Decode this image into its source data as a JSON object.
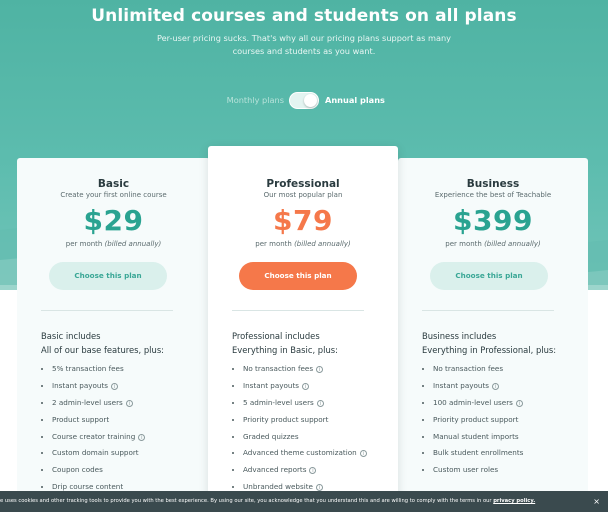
{
  "hero": {
    "headline": "Unlimited courses and students on all plans",
    "subtext": "Per-user pricing sucks. That's why all our pricing plans support as many courses and students as you want."
  },
  "billing_toggle": {
    "left_label": "Monthly plans",
    "right_label": "Annual plans",
    "selected": "Annual plans"
  },
  "colors": {
    "brand_teal": "#4fb3a3",
    "price_teal": "#2aa391",
    "price_orange": "#f5784a",
    "cookie_bar": "#3a4a4e"
  },
  "plans": [
    {
      "name": "Basic",
      "tagline": "Create your first online course",
      "price": "$29",
      "period": "per month",
      "billing_note": "(billed annually)",
      "cta": "Choose this plan",
      "includes_title": "Basic includes",
      "includes_sub": "All of our base features, plus:",
      "features": [
        {
          "label": "5% transaction fees",
          "info": false
        },
        {
          "label": "Instant payouts",
          "info": true
        },
        {
          "label": "2 admin-level users",
          "info": true
        },
        {
          "label": "Product support",
          "info": false
        },
        {
          "label": "Course creator training",
          "info": true
        },
        {
          "label": "Custom domain support",
          "info": false
        },
        {
          "label": "Coupon codes",
          "info": false
        },
        {
          "label": "Drip course content",
          "info": false
        }
      ]
    },
    {
      "name": "Professional",
      "tagline": "Our most popular plan",
      "price": "$79",
      "period": "per month",
      "billing_note": "(billed annually)",
      "cta": "Choose this plan",
      "includes_title": "Professional includes",
      "includes_sub": "Everything in Basic, plus:",
      "features": [
        {
          "label": "No transaction fees",
          "info": true
        },
        {
          "label": "Instant payouts",
          "info": true
        },
        {
          "label": "5 admin-level users",
          "info": true
        },
        {
          "label": "Priority product support",
          "info": false
        },
        {
          "label": "Graded quizzes",
          "info": false
        },
        {
          "label": "Advanced theme customization",
          "info": true
        },
        {
          "label": "Advanced reports",
          "info": true
        },
        {
          "label": "Unbranded website",
          "info": true
        }
      ]
    },
    {
      "name": "Business",
      "tagline": "Experience the best of Teachable",
      "price": "$399",
      "period": "per month",
      "billing_note": "(billed annually)",
      "cta": "Choose this plan",
      "includes_title": "Business includes",
      "includes_sub": "Everything in Professional, plus:",
      "features": [
        {
          "label": "No transaction fees",
          "info": false
        },
        {
          "label": "Instant payouts",
          "info": true
        },
        {
          "label": "100 admin-level users",
          "info": true
        },
        {
          "label": "Priority product support",
          "info": false
        },
        {
          "label": "Manual student imports",
          "info": false
        },
        {
          "label": "Bulk student enrollments",
          "info": false
        },
        {
          "label": "Custom user roles",
          "info": false
        }
      ]
    }
  ],
  "cookie_banner": {
    "text": "e uses cookies and other tracking tools to provide you with the best experience. By using our site, you acknowledge that you understand this and are willing to comply with the terms in our ",
    "link": "privacy policy.",
    "close": "×"
  }
}
